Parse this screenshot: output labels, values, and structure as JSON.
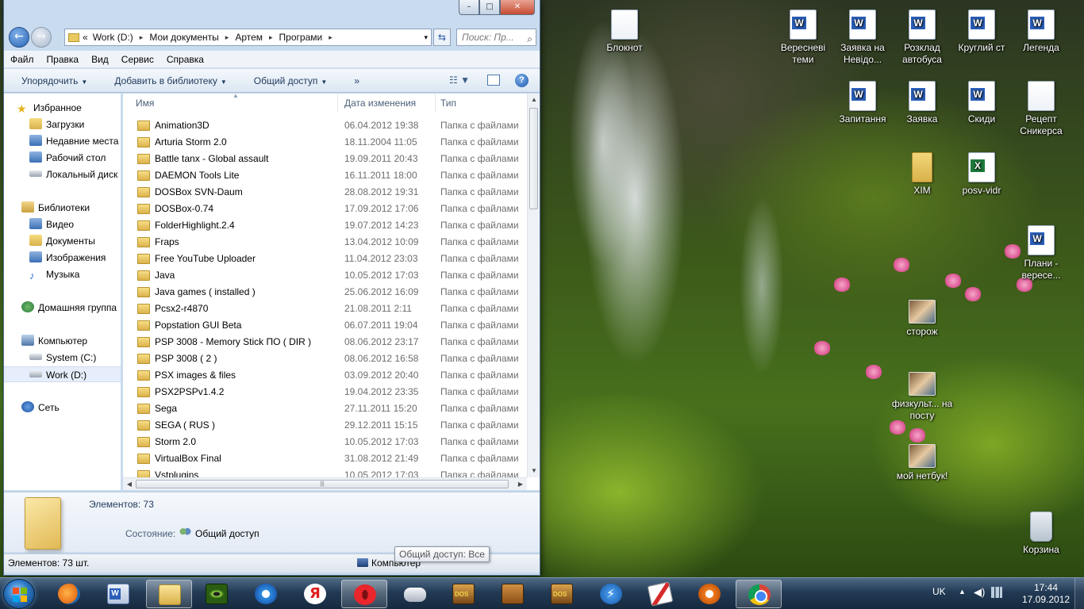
{
  "window": {
    "controls": [
      "–",
      "□",
      "✕"
    ],
    "address": {
      "prefix": "«",
      "segments": [
        "Work (D:)",
        "Мои документы",
        "Артем",
        "Програми"
      ],
      "separator": "▸",
      "dropdown": "▾"
    },
    "search_placeholder": "Поиск: Пр...",
    "menu": [
      "Файл",
      "Правка",
      "Вид",
      "Сервис",
      "Справка"
    ],
    "toolbar": {
      "organize": "Упорядочить",
      "add_to_library": "Добавить в библиотеку",
      "share": "Общий доступ",
      "more": "»",
      "help": "?"
    },
    "nav": {
      "favorites": "Избранное",
      "downloads": "Загрузки",
      "recent": "Недавние места",
      "desktop": "Рабочий стол",
      "local_disk": "Локальный диск",
      "libraries": "Библиотеки",
      "video": "Видео",
      "documents": "Документы",
      "images": "Изображения",
      "music": "Музыка",
      "homegroup": "Домашняя группа",
      "computer": "Компьютер",
      "system_c": "System (C:)",
      "work_d": "Work (D:)",
      "network": "Сеть"
    },
    "columns": {
      "name": "Имя",
      "date": "Дата изменения",
      "type": "Тип"
    },
    "files": [
      {
        "name": "Animation3D",
        "date": "06.04.2012 19:38",
        "type": "Папка с файлами"
      },
      {
        "name": "Arturia Storm 2.0",
        "date": "18.11.2004 11:05",
        "type": "Папка с файлами"
      },
      {
        "name": "Battle tanx  - Global assault",
        "date": "19.09.2011 20:43",
        "type": "Папка с файлами"
      },
      {
        "name": "DAEMON Tools Lite",
        "date": "16.11.2011 18:00",
        "type": "Папка с файлами"
      },
      {
        "name": "DOSBox SVN-Daum",
        "date": "28.08.2012 19:31",
        "type": "Папка с файлами"
      },
      {
        "name": "DOSBox-0.74",
        "date": "17.09.2012 17:06",
        "type": "Папка с файлами"
      },
      {
        "name": "FolderHighlight.2.4",
        "date": "19.07.2012 14:23",
        "type": "Папка с файлами"
      },
      {
        "name": "Fraps",
        "date": "13.04.2012 10:09",
        "type": "Папка с файлами"
      },
      {
        "name": "Free YouTube Uploader",
        "date": "11.04.2012 23:03",
        "type": "Папка с файлами"
      },
      {
        "name": "Java",
        "date": "10.05.2012 17:03",
        "type": "Папка с файлами"
      },
      {
        "name": "Java games ( installed )",
        "date": "25.06.2012 16:09",
        "type": "Папка с файлами"
      },
      {
        "name": "Pcsx2-r4870",
        "date": "21.08.2011 2:11",
        "type": "Папка с файлами"
      },
      {
        "name": "Popstation GUI Beta",
        "date": "06.07.2011 19:04",
        "type": "Папка с файлами"
      },
      {
        "name": "PSP 3008 - Memory Stick ПО ( DIR )",
        "date": "08.06.2012 23:17",
        "type": "Папка с файлами"
      },
      {
        "name": "PSP 3008 ( 2 )",
        "date": "08.06.2012 16:58",
        "type": "Папка с файлами"
      },
      {
        "name": "PSX images & files",
        "date": "03.09.2012 20:40",
        "type": "Папка с файлами"
      },
      {
        "name": "PSX2PSPv1.4.2",
        "date": "19.04.2012 23:35",
        "type": "Папка с файлами"
      },
      {
        "name": "Sega",
        "date": "27.11.2011 15:20",
        "type": "Папка с файлами"
      },
      {
        "name": "SEGA ( RUS )",
        "date": "29.12.2011 15:15",
        "type": "Папка с файлами"
      },
      {
        "name": "Storm 2.0",
        "date": "10.05.2012 17:03",
        "type": "Папка с файлами"
      },
      {
        "name": "VirtualBox Final",
        "date": "31.08.2012 21:49",
        "type": "Папка с файлами"
      },
      {
        "name": "Vstplugins",
        "date": "10.05.2012 17:03",
        "type": "Папка с файлами"
      }
    ],
    "details": {
      "count": "Элементов: 73",
      "state_label": "Состояние:",
      "state_value": "Общий доступ"
    },
    "tooltip": "Общий доступ: Все",
    "status": {
      "left": "Элементов: 73 шт.",
      "right": "Компьютер"
    }
  },
  "desktop_icons": [
    {
      "label": "Блокнот",
      "kind": "txt"
    },
    {
      "label": "Вересневі теми",
      "kind": "word"
    },
    {
      "label": "Заявка на Невідо...",
      "kind": "word"
    },
    {
      "label": "Розклад автобуса",
      "kind": "word"
    },
    {
      "label": "Круглий ст",
      "kind": "word"
    },
    {
      "label": "Легенда",
      "kind": "word"
    },
    {
      "label": "Запитання",
      "kind": "word"
    },
    {
      "label": "Заявка",
      "kind": "word"
    },
    {
      "label": "Скиди",
      "kind": "word"
    },
    {
      "label": "Рецепт Сникерса",
      "kind": "txt"
    },
    {
      "label": "XIM",
      "kind": "folder"
    },
    {
      "label": "posv-vidr",
      "kind": "excel"
    },
    {
      "label": "Плани - вересе...",
      "kind": "word"
    },
    {
      "label": "сторож",
      "kind": "photo"
    },
    {
      "label": "физкульт... на посту",
      "kind": "photo"
    },
    {
      "label": "мой нетбук!",
      "kind": "photo"
    },
    {
      "label": "Корзина",
      "kind": "bin"
    }
  ],
  "taskbar": {
    "apps": [
      "windows-media-player-icon",
      "word-icon",
      "explorer-icon",
      "eye-app-icon",
      "internet-explorer-icon",
      "yandex-icon",
      "opera-icon",
      "gamepad-icon",
      "dosbox-icon",
      "dosbox-icon",
      "dosbox-icon",
      "bolt-app-icon",
      "cards-icon",
      "avast-icon",
      "chrome-icon"
    ],
    "tray": {
      "language": "UK",
      "time": "17:44",
      "date": "17.09.2012"
    }
  }
}
